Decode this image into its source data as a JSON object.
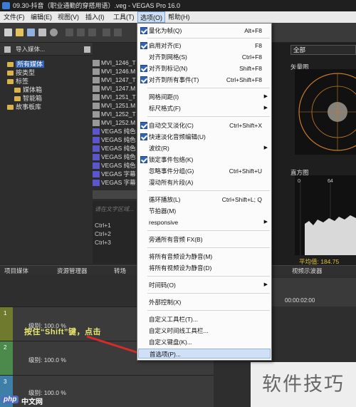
{
  "window": {
    "title": "09.30-抖音（职业通勤的穿搭用语）.veg - VEGAS Pro 16.0"
  },
  "menubar": [
    {
      "label": "文件(F)"
    },
    {
      "label": "编辑(E)"
    },
    {
      "label": "视图(V)"
    },
    {
      "label": "插入(I)"
    },
    {
      "label": "工具(T)"
    },
    {
      "label": "选项(O)"
    },
    {
      "label": "帮助(H)"
    }
  ],
  "left_panel": {
    "import_label": "导入媒体...",
    "tree": [
      {
        "label": "所有媒体",
        "selected": true
      },
      {
        "label": "按类型"
      },
      {
        "label": "标签"
      },
      {
        "label": "媒体箱"
      },
      {
        "label": "智能箱"
      },
      {
        "label": "故事板库"
      }
    ],
    "files": [
      "MVI_1246_T",
      "MVI_1246.M",
      "MVI_1247_T",
      "MVI_1247.M",
      "MVI_1251_T",
      "MVI_1251.M",
      "MVI_1252_T",
      "MVI_1252.M",
      "VEGAS 纯色",
      "VEGAS 纯色",
      "VEGAS 纯色",
      "VEGAS 纯色",
      "VEGAS 纯色",
      "VEGAS 字幕",
      "VEGAS 字幕"
    ],
    "command_hint": "请在文字区域...",
    "commands": [
      "Ctrl+1",
      "Ctrl+2",
      "Ctrl+3"
    ]
  },
  "tabs": [
    {
      "label": "项目媒体"
    },
    {
      "label": "资源管理器"
    },
    {
      "label": "转场"
    }
  ],
  "right_panel": {
    "scope_mode": "全部",
    "vectorscope_label": "矢量图",
    "histogram_label": "直方图",
    "histogram_ticks": [
      "0",
      "64"
    ],
    "average_label": "平均值: 184.75",
    "preview_tab": "视频示波器"
  },
  "timeline": {
    "timecode": "00:00:02:00",
    "tracks": [
      {
        "number": "1",
        "level": "级别: 100.0 %"
      },
      {
        "number": "2",
        "level": "级别: 100.0 %"
      },
      {
        "number": "3",
        "level": "级别: 100.0 %"
      }
    ]
  },
  "annotation": "按住“Shift”键，点击",
  "watermark": "软件技巧",
  "footer_brand": {
    "badge": "php",
    "site": "中文网"
  },
  "options_menu": {
    "items": [
      {
        "label": "量化为帧(Q)",
        "shortcut": "Alt+F8",
        "checked": true
      },
      {
        "label": "启用对齐(E)",
        "shortcut": "F8",
        "checked": true
      },
      {
        "label": "对齐到网格(S)",
        "shortcut": "Ctrl+F8",
        "checked": false
      },
      {
        "label": "对齐到标记(N)",
        "shortcut": "Shift+F8",
        "checked": true
      },
      {
        "label": "对齐到所有事件(T)",
        "shortcut": "Ctrl+Shift+F8",
        "checked": true
      },
      {
        "label": "网格间距(I)",
        "shortcut": "",
        "submenu": true
      },
      {
        "label": "标尺格式(F)",
        "shortcut": "",
        "submenu": true
      },
      {
        "label": "自动交叉淡化(C)",
        "shortcut": "Ctrl+Shift+X",
        "checked": true
      },
      {
        "label": "快速淡化音频编辑(U)",
        "shortcut": "",
        "checked": true
      },
      {
        "label": "波纹(R)",
        "shortcut": "",
        "submenu": true
      },
      {
        "label": "锁定事件包络(K)",
        "shortcut": "",
        "checked": true
      },
      {
        "label": "忽略事件分组(G)",
        "shortcut": "Ctrl+Shift+U"
      },
      {
        "label": "漫动所有片段(A)",
        "shortcut": ""
      },
      {
        "label": "循环播放(L)",
        "shortcut": "Ctrl+Shift+L; Q"
      },
      {
        "label": "节拍器(M)",
        "shortcut": ""
      },
      {
        "label": "responsive",
        "shortcut": "",
        "submenu": true
      },
      {
        "label": "旁通所有音频 FX(B)",
        "shortcut": ""
      },
      {
        "label": "将所有音频设为静音(M)",
        "shortcut": ""
      },
      {
        "label": "将所有视频设为静音(D)",
        "shortcut": ""
      },
      {
        "label": "时间码(O)",
        "shortcut": "",
        "submenu": true
      },
      {
        "label": "外部控制(X)",
        "shortcut": ""
      },
      {
        "label": "自定义工具栏(T)...",
        "shortcut": ""
      },
      {
        "label": "自定义时间线工具栏...",
        "shortcut": ""
      },
      {
        "label": "自定义键盘(K)...",
        "shortcut": ""
      },
      {
        "label": "首选项(P)...",
        "shortcut": "",
        "hover": true
      }
    ]
  }
}
